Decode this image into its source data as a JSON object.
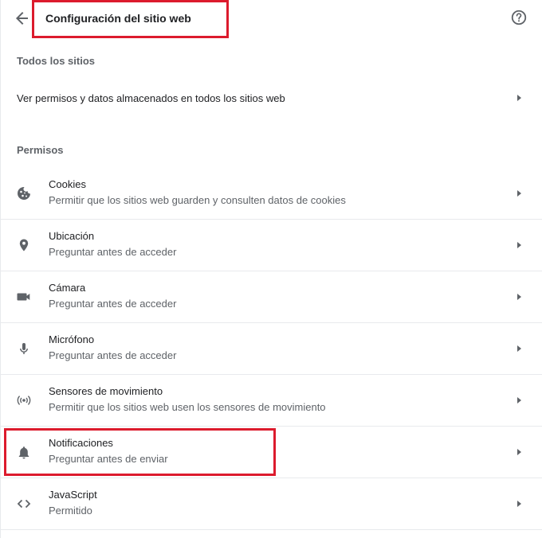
{
  "header": {
    "title": "Configuración del sitio web",
    "back_icon": "arrow-back-icon",
    "help_icon": "help-circle-icon"
  },
  "all_sites": {
    "heading": "Todos los sitios",
    "link_label": "Ver permisos y datos almacenados en todos los sitios web"
  },
  "permissions": {
    "heading": "Permisos",
    "items": [
      {
        "title": "Cookies",
        "subtitle": "Permitir que los sitios web guarden y consulten datos de cookies",
        "icon": "cookie-icon"
      },
      {
        "title": "Ubicación",
        "subtitle": "Preguntar antes de acceder",
        "icon": "location-pin-icon"
      },
      {
        "title": "Cámara",
        "subtitle": "Preguntar antes de acceder",
        "icon": "camera-icon"
      },
      {
        "title": "Micrófono",
        "subtitle": "Preguntar antes de acceder",
        "icon": "microphone-icon"
      },
      {
        "title": "Sensores de movimiento",
        "subtitle": "Permitir que los sitios web usen los sensores de movimiento",
        "icon": "sensors-icon"
      },
      {
        "title": "Notificaciones",
        "subtitle": "Preguntar antes de enviar",
        "icon": "bell-icon"
      },
      {
        "title": "JavaScript",
        "subtitle": "Permitido",
        "icon": "code-icon"
      }
    ]
  },
  "colors": {
    "highlight_border": "#dc1b2d",
    "icon": "#5f6368",
    "text_primary": "#202124",
    "text_secondary": "#5f6368",
    "divider": "#e8eaed"
  }
}
